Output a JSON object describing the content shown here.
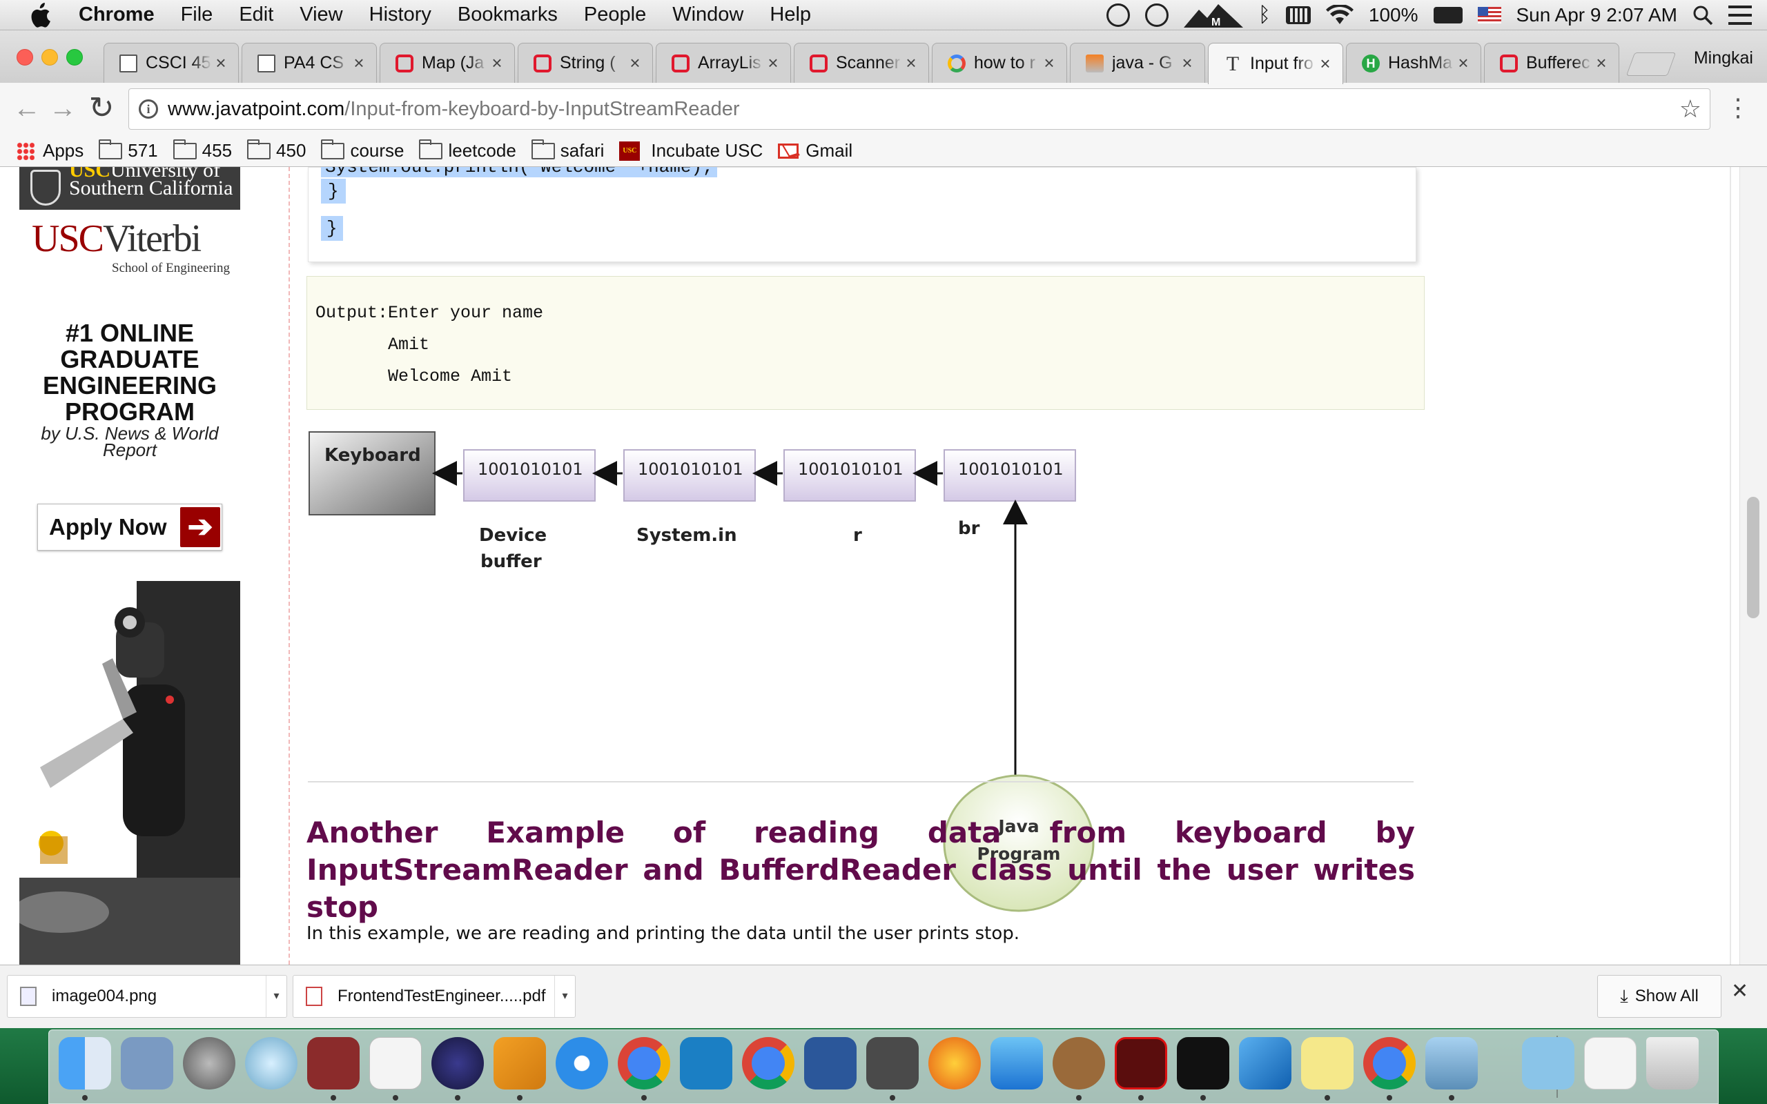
{
  "menubar": {
    "app": "Chrome",
    "items": [
      "File",
      "Edit",
      "View",
      "History",
      "Bookmarks",
      "People",
      "Window",
      "Help"
    ],
    "battery": "100%",
    "datetime": "Sun Apr 9  2:07 AM"
  },
  "tabs": [
    {
      "label": "CSCI 45",
      "icon": "document-icon"
    },
    {
      "label": "PA4 CS",
      "icon": "document-icon"
    },
    {
      "label": "Map (Ja",
      "icon": "oracle-icon"
    },
    {
      "label": "String (",
      "icon": "oracle-icon"
    },
    {
      "label": "ArrayLis",
      "icon": "oracle-icon"
    },
    {
      "label": "Scanner",
      "icon": "oracle-icon"
    },
    {
      "label": "how to r",
      "icon": "google-icon"
    },
    {
      "label": "java - G",
      "icon": "stackoverflow-icon"
    },
    {
      "label": "Input fro",
      "icon": "javatpoint-icon",
      "active": true
    },
    {
      "label": "HashMa",
      "icon": "green-h-icon"
    },
    {
      "label": "Bufferec",
      "icon": "oracle-icon"
    }
  ],
  "profile_name": "Mingkai",
  "address": {
    "host": "www.javatpoint.com",
    "path": "/Input-from-keyboard-by-InputStreamReader"
  },
  "bookmarks": [
    {
      "label": "Apps",
      "icon": "apps-grid-icon"
    },
    {
      "label": "571",
      "icon": "folder-icon"
    },
    {
      "label": "455",
      "icon": "folder-icon"
    },
    {
      "label": "450",
      "icon": "folder-icon"
    },
    {
      "label": "course",
      "icon": "folder-icon"
    },
    {
      "label": "leetcode",
      "icon": "folder-icon"
    },
    {
      "label": "safari",
      "icon": "folder-icon"
    },
    {
      "label": "Incubate USC",
      "icon": "usc-icon"
    },
    {
      "label": "Gmail",
      "icon": "gmail-icon"
    }
  ],
  "ad": {
    "top_text_1": "University of",
    "top_text_2": "Southern California",
    "brand_usc": "USC",
    "brand_viterbi": "Viterbi",
    "school": "School of Engineering",
    "headline": "#1 ONLINE GRADUATE ENGINEERING PROGRAM",
    "subline": "by U.S. News & World Report",
    "cta": "Apply Now"
  },
  "code": {
    "partial_line": "System.out.println(\"Welcome \"+name);",
    "brace1": "}",
    "brace2": "}"
  },
  "output": {
    "line1": "Output:Enter your name",
    "line2": "       Amit",
    "line3": "       Welcome Amit"
  },
  "diagram": {
    "keyboard": "Keyboard",
    "boxes": [
      "1001010101",
      "1001010101",
      "1001010101",
      "1001010101"
    ],
    "labels": [
      "Device",
      "buffer",
      "System.in",
      "r",
      "br"
    ],
    "program_line1": "Java",
    "program_line2": "Program"
  },
  "section": {
    "heading": "Another Example of reading data from keyboard by InputStreamReader and BufferdReader class until the user writes stop",
    "text": "In this example, we are reading and printing the data until the user prints stop."
  },
  "downloads": {
    "item1": "image004.png",
    "item2": "FrontendTestEngineer.....pdf",
    "show_all": "Show All"
  },
  "colors": {
    "heading": "#610b4b",
    "selection": "#b5d5fd",
    "output_bg": "#fbfbef",
    "usc_red": "#990000"
  }
}
